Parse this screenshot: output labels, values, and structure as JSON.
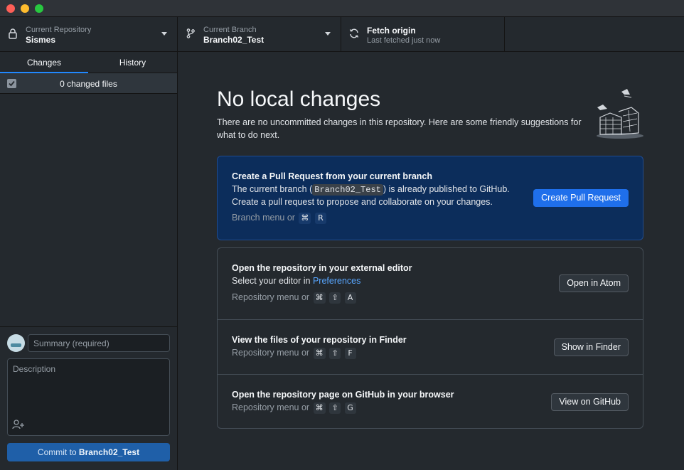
{
  "toolbar": {
    "repo": {
      "label": "Current Repository",
      "value": "Sismes",
      "icon": "lock-icon"
    },
    "branch": {
      "label": "Current Branch",
      "value": "Branch02_Test",
      "icon": "git-branch-icon"
    },
    "fetch": {
      "label": "Fetch origin",
      "sub": "Last fetched just now",
      "icon": "sync-icon"
    }
  },
  "sidebar": {
    "tabs": [
      {
        "label": "Changes"
      },
      {
        "label": "History"
      }
    ],
    "changes_label": "0 changed files",
    "summary_placeholder": "Summary (required)",
    "description_placeholder": "Description",
    "commit_prefix": "Commit to ",
    "commit_branch": "Branch02_Test"
  },
  "main": {
    "title": "No local changes",
    "intro": "There are no uncommitted changes in this repository. Here are some friendly suggestions for what to do next.",
    "pr": {
      "title": "Create a Pull Request from your current branch",
      "line1_a": "The current branch (",
      "line1_branch": "Branch02_Test",
      "line1_b": ") is already published to GitHub.",
      "line2": "Create a pull request to propose and collaborate on your changes.",
      "hint": "Branch menu or",
      "keys": [
        "⌘",
        "R"
      ],
      "button": "Create Pull Request"
    },
    "editor": {
      "title": "Open the repository in your external editor",
      "line1": "Select your editor in ",
      "link": "Preferences",
      "hint": "Repository menu or",
      "keys": [
        "⌘",
        "⇧",
        "A"
      ],
      "button": "Open in Atom"
    },
    "finder": {
      "title": "View the files of your repository in Finder",
      "hint": "Repository menu or",
      "keys": [
        "⌘",
        "⇧",
        "F"
      ],
      "button": "Show in Finder"
    },
    "github": {
      "title": "Open the repository page on GitHub in your browser",
      "hint": "Repository menu or",
      "keys": [
        "⌘",
        "⇧",
        "G"
      ],
      "button": "View on GitHub"
    }
  },
  "colors": {
    "accent": "#1f6feb",
    "pr_card_bg": "#0c2d5b",
    "link": "#58a6ff",
    "background": "#24292e"
  }
}
